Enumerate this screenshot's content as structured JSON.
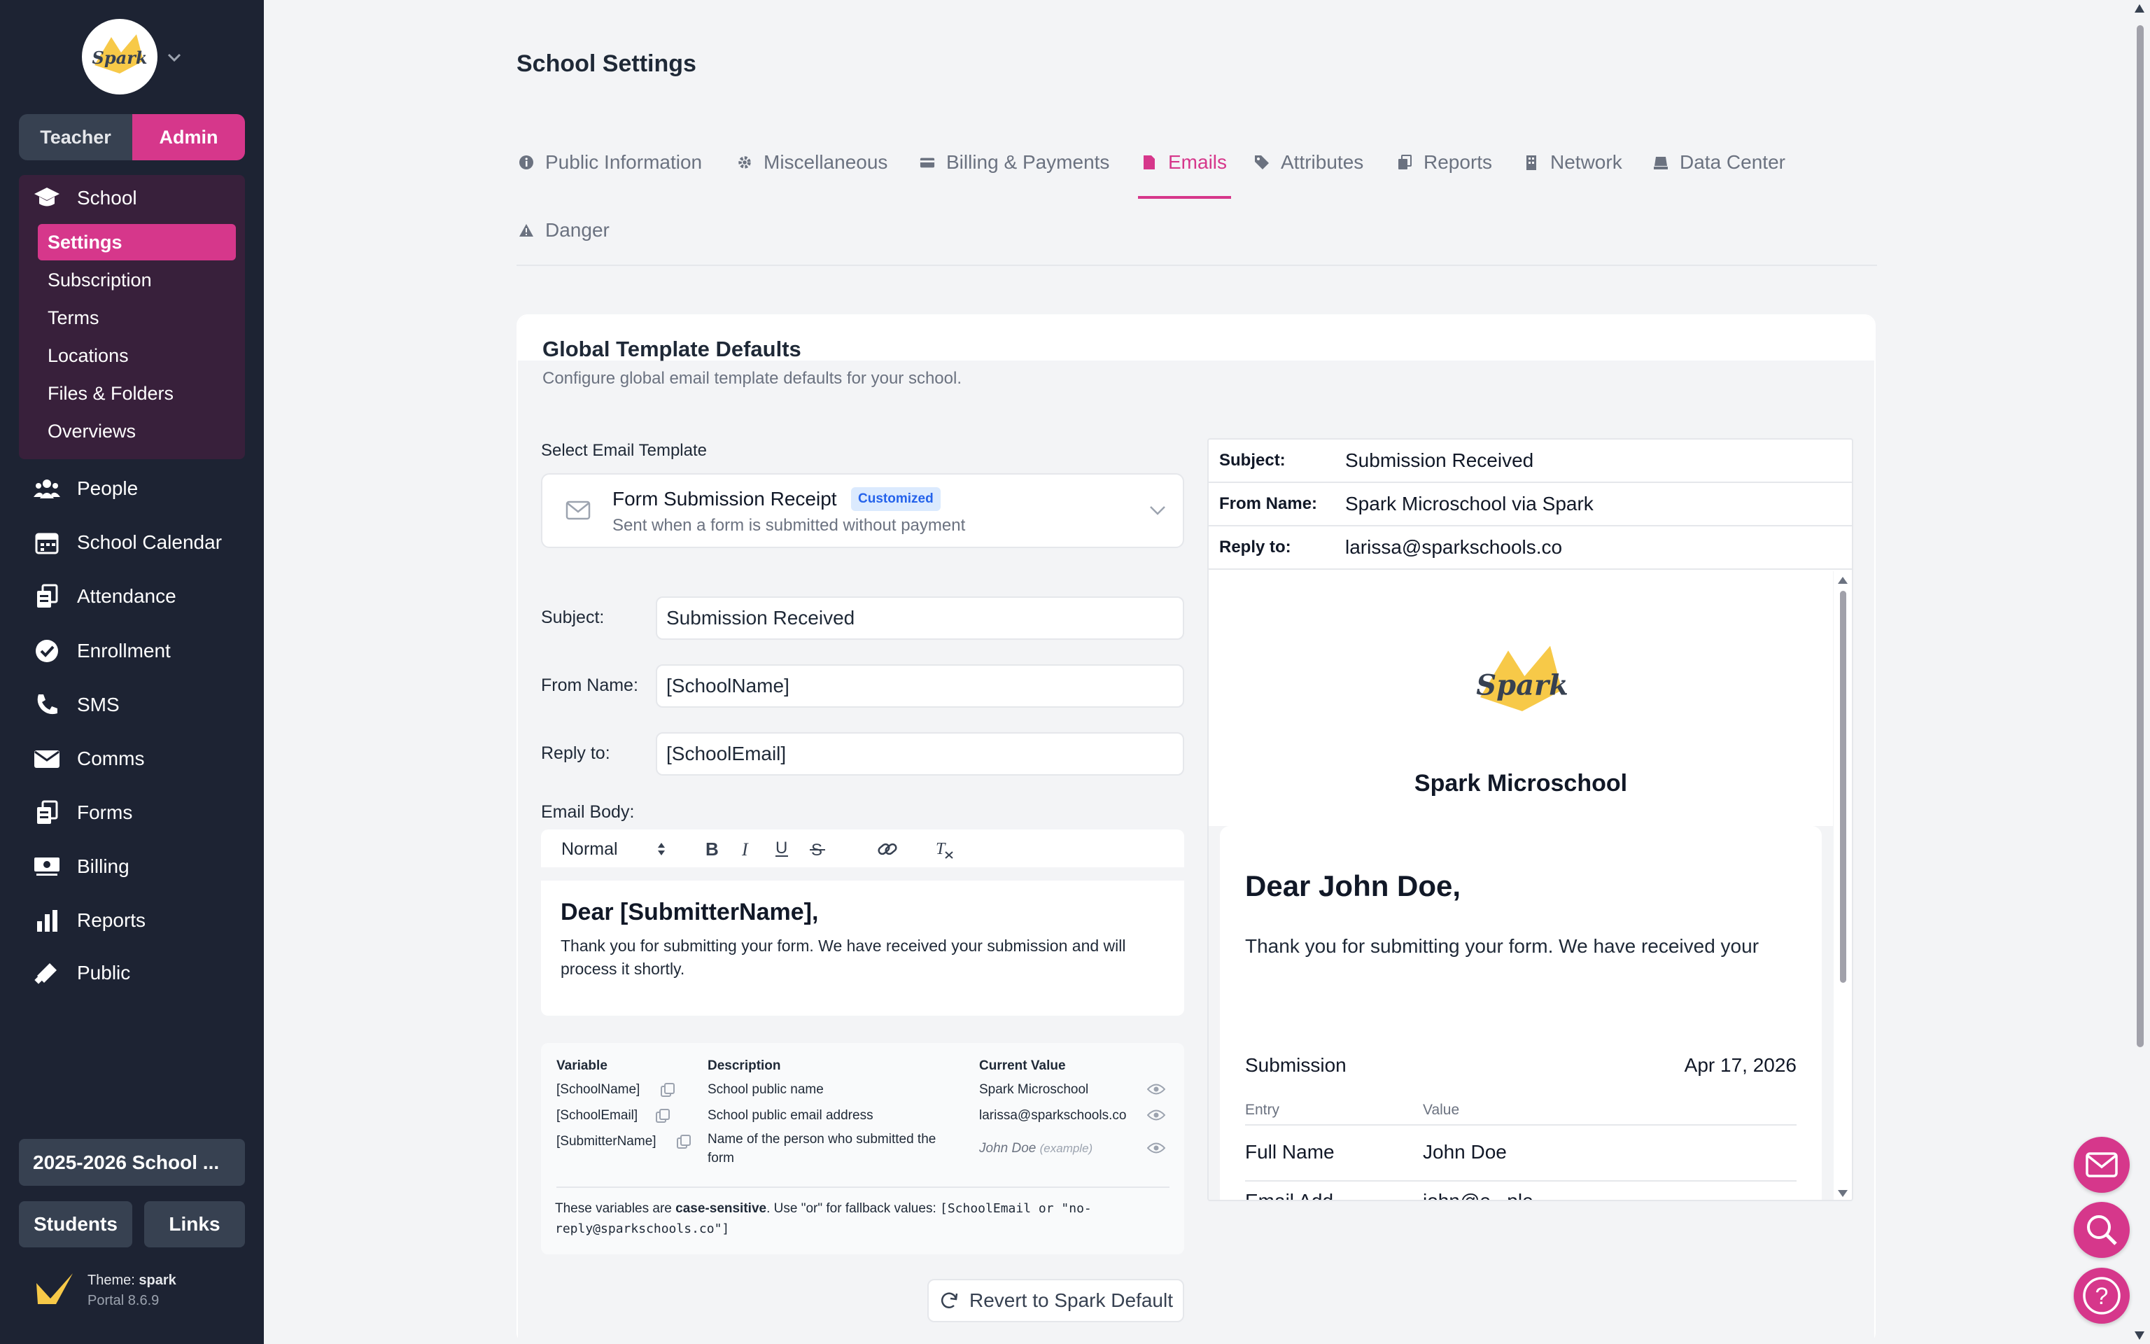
{
  "sidebar": {
    "roles": {
      "teacher": "Teacher",
      "admin": "Admin"
    },
    "school_label": "School",
    "school_items": [
      "Settings",
      "Subscription",
      "Terms",
      "Locations",
      "Files & Folders",
      "Overviews"
    ],
    "nav": [
      "People",
      "School Calendar",
      "Attendance",
      "Enrollment",
      "SMS",
      "Comms",
      "Forms",
      "Billing",
      "Reports",
      "Public"
    ],
    "year": "2025-2026 School ...",
    "students": "Students",
    "links": "Links",
    "theme_prefix": "Theme: ",
    "theme_name": "spark",
    "version": "Portal 8.6.9",
    "logo_text": "Spark"
  },
  "page": {
    "title": "School Settings",
    "tabs": [
      "Public Information",
      "Miscellaneous",
      "Billing & Payments",
      "Emails",
      "Attributes",
      "Reports",
      "Network",
      "Data Center",
      "Danger"
    ],
    "active_tab": "Emails"
  },
  "card": {
    "title": "Global Template Defaults",
    "description": "Configure global email template defaults for your school.",
    "select_label": "Select Email Template",
    "template_name": "Form Submission Receipt",
    "template_badge": "Customized",
    "template_desc": "Sent when a form is submitted without payment",
    "subject_label": "Subject:",
    "subject_value": "Submission Received",
    "from_label": "From Name:",
    "from_value": "[SchoolName]",
    "reply_label": "Reply to:",
    "reply_value": "[SchoolEmail]",
    "body_label": "Email Body:",
    "toolbar_format": "Normal",
    "body_heading": "Dear [SubmitterName],",
    "body_text": "Thank you for submitting your form. We have received your submission and will process it shortly.",
    "revert": "Revert to Spark Default"
  },
  "variables": {
    "headers": {
      "variable": "Variable",
      "description": "Description",
      "current": "Current Value"
    },
    "rows": [
      {
        "name": "[SchoolName]",
        "desc": "School public name",
        "value": "Spark Microschool",
        "example": ""
      },
      {
        "name": "[SchoolEmail]",
        "desc": "School public email address",
        "value": "larissa@sparkschools.co",
        "example": ""
      },
      {
        "name": "[SubmitterName]",
        "desc": "Name of the person who submitted the",
        "desc2": "form",
        "value": "John Doe",
        "example": "(example)"
      }
    ],
    "note_a": "These variables are ",
    "note_b": "case-sensitive",
    "note_c": ". Use \"or\" for fallback values: ",
    "note_code1": "[SchoolEmail or \"no-",
    "note_code2": "reply@sparkschools.co\"]"
  },
  "preview": {
    "subject_label": "Subject:",
    "subject": "Submission Received",
    "from_label": "From Name:",
    "from": "Spark Microschool via Spark",
    "reply_label": "Reply to:",
    "reply": "larissa@sparkschools.co",
    "school_name": "Spark Microschool",
    "greeting": "Dear John Doe,",
    "message": "Thank you for submitting your form. We have received your submission and will process it shortly.",
    "submission_label": "Submission",
    "submission_date": "Apr 17, 2026",
    "entry_header": "Entry",
    "value_header": "Value",
    "entry1_label": "Full Name",
    "entry1_value": "John Doe",
    "entry2_label": "Email Add...",
    "entry2_value": "john@e...ple"
  },
  "colors": {
    "accent": "#d6378b",
    "sidebar": "#1d2333",
    "school_box": "#38203b"
  }
}
